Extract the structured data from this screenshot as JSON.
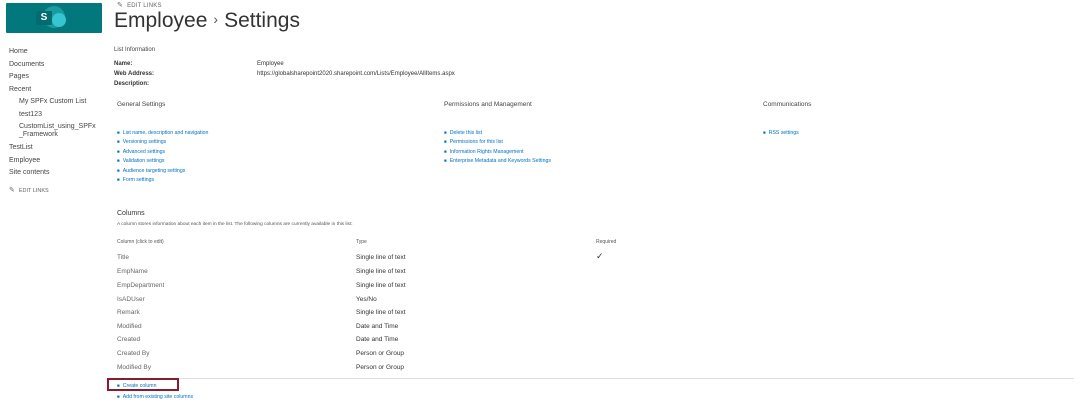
{
  "header": {
    "edit_links": "EDIT LINKS",
    "title_part1": "Employee",
    "title_separator": "›",
    "title_part2": "Settings",
    "logo_letter": "S"
  },
  "leftnav": {
    "items": [
      {
        "label": "Home",
        "level": 0
      },
      {
        "label": "Documents",
        "level": 0
      },
      {
        "label": "Pages",
        "level": 0
      },
      {
        "label": "Recent",
        "level": 0
      },
      {
        "label": "My SPFx Custom List",
        "level": 1
      },
      {
        "label": "test123",
        "level": 1
      },
      {
        "label": "CustomList_using_SPFx_Framework",
        "level": 1
      },
      {
        "label": "TestList",
        "level": 0
      },
      {
        "label": "Employee",
        "level": 0
      },
      {
        "label": "Site contents",
        "level": 0
      }
    ],
    "edit_links": "EDIT LINKS"
  },
  "list_info": {
    "heading": "List Information",
    "name_label": "Name:",
    "name_value": "Employee",
    "web_label": "Web Address:",
    "web_value": "https://globalsharepoint2020.sharepoint.com/Lists/Employee/AllItems.aspx",
    "desc_label": "Description:"
  },
  "general": {
    "heading": "General Settings",
    "links": [
      "List name, description and navigation",
      "Versioning settings",
      "Advanced settings",
      "Validation settings",
      "Audience targeting settings",
      "Form settings"
    ]
  },
  "permissions": {
    "heading": "Permissions and Management",
    "links": [
      "Delete this list",
      "Permissions for this list",
      "Information Rights Management",
      "Enterprise Metadata and Keywords Settings"
    ]
  },
  "communications": {
    "heading": "Communications",
    "links": [
      "RSS settings"
    ]
  },
  "columns": {
    "title": "Columns",
    "description": "A column stores information about each item in the list. The following columns are currently available in this list:",
    "headers": {
      "name": "Column (click to edit)",
      "type": "Type",
      "required": "Required"
    },
    "rows": [
      {
        "name": "Title",
        "type": "Single line of text",
        "required": "✓"
      },
      {
        "name": "EmpName",
        "type": "Single line of text",
        "required": ""
      },
      {
        "name": "EmpDepartment",
        "type": "Single line of text",
        "required": ""
      },
      {
        "name": "IsADUser",
        "type": "Yes/No",
        "required": ""
      },
      {
        "name": "Remark",
        "type": "Single line of text",
        "required": ""
      },
      {
        "name": "Modified",
        "type": "Date and Time",
        "required": ""
      },
      {
        "name": "Created",
        "type": "Date and Time",
        "required": ""
      },
      {
        "name": "Created By",
        "type": "Person or Group",
        "required": ""
      },
      {
        "name": "Modified By",
        "type": "Person or Group",
        "required": ""
      }
    ]
  },
  "bottom_links": {
    "create_column": "Create column",
    "add_existing": "Add from existing site columns"
  },
  "colors": {
    "link": "#0072c6",
    "brand": "#03787c",
    "highlight_box": "#8b1a2a"
  }
}
